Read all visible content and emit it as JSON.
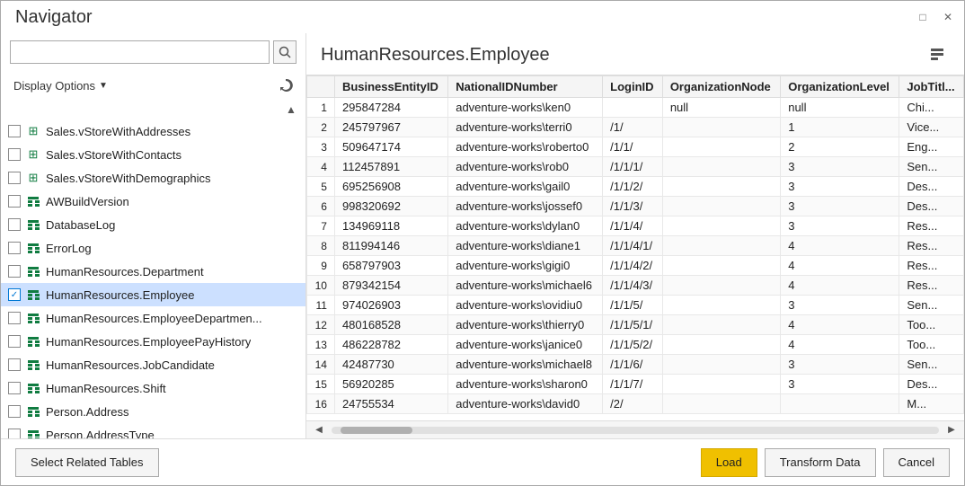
{
  "window": {
    "title": "Navigator",
    "preview_title": "HumanResources.Employee"
  },
  "titlebar": {
    "minimize_label": "□",
    "close_label": "✕"
  },
  "sidebar": {
    "search_placeholder": "",
    "display_options_label": "Display Options",
    "items": [
      {
        "id": "SalesStoreWithAddresses",
        "label": "Sales.vStoreWithAddresses",
        "type": "view",
        "checked": false,
        "selected": false
      },
      {
        "id": "SalesStoreWithContacts",
        "label": "Sales.vStoreWithContacts",
        "type": "view",
        "checked": false,
        "selected": false
      },
      {
        "id": "SalesStoreWithDemographics",
        "label": "Sales.vStoreWithDemographics",
        "type": "view",
        "checked": false,
        "selected": false
      },
      {
        "id": "AWBuildVersion",
        "label": "AWBuildVersion",
        "type": "table",
        "checked": false,
        "selected": false
      },
      {
        "id": "DatabaseLog",
        "label": "DatabaseLog",
        "type": "table",
        "checked": false,
        "selected": false
      },
      {
        "id": "ErrorLog",
        "label": "ErrorLog",
        "type": "table",
        "checked": false,
        "selected": false
      },
      {
        "id": "HumanResourcesDepartment",
        "label": "HumanResources.Department",
        "type": "table",
        "checked": false,
        "selected": false
      },
      {
        "id": "HumanResourcesEmployee",
        "label": "HumanResources.Employee",
        "type": "table",
        "checked": true,
        "selected": true
      },
      {
        "id": "HumanResourcesEmployeeDepartment",
        "label": "HumanResources.EmployeeDepartmen...",
        "type": "table",
        "checked": false,
        "selected": false
      },
      {
        "id": "HumanResourcesEmployeePayHistory",
        "label": "HumanResources.EmployeePayHistory",
        "type": "table",
        "checked": false,
        "selected": false
      },
      {
        "id": "HumanResourcesJobCandidate",
        "label": "HumanResources.JobCandidate",
        "type": "table",
        "checked": false,
        "selected": false
      },
      {
        "id": "HumanResourcesShift",
        "label": "HumanResources.Shift",
        "type": "table",
        "checked": false,
        "selected": false
      },
      {
        "id": "PersonAddress",
        "label": "Person.Address",
        "type": "table",
        "checked": false,
        "selected": false
      },
      {
        "id": "PersonAddressType",
        "label": "Person.AddressType",
        "type": "table",
        "checked": false,
        "selected": false
      }
    ]
  },
  "table": {
    "columns": [
      "",
      "BusinessEntityID",
      "NationalIDNumber",
      "LoginID",
      "OrganizationNode",
      "OrganizationLevel",
      "JobTitl..."
    ],
    "rows": [
      [
        "1",
        "295847284",
        "adventure-works\\ken0",
        "",
        "null",
        "null",
        "Chi..."
      ],
      [
        "2",
        "245797967",
        "adventure-works\\terri0",
        "/1/",
        "",
        "1",
        "Vice..."
      ],
      [
        "3",
        "509647174",
        "adventure-works\\roberto0",
        "/1/1/",
        "",
        "2",
        "Eng..."
      ],
      [
        "4",
        "112457891",
        "adventure-works\\rob0",
        "/1/1/1/",
        "",
        "3",
        "Sen..."
      ],
      [
        "5",
        "695256908",
        "adventure-works\\gail0",
        "/1/1/2/",
        "",
        "3",
        "Des..."
      ],
      [
        "6",
        "998320692",
        "adventure-works\\jossef0",
        "/1/1/3/",
        "",
        "3",
        "Des..."
      ],
      [
        "7",
        "134969118",
        "adventure-works\\dylan0",
        "/1/1/4/",
        "",
        "3",
        "Res..."
      ],
      [
        "8",
        "811994146",
        "adventure-works\\diane1",
        "/1/1/4/1/",
        "",
        "4",
        "Res..."
      ],
      [
        "9",
        "658797903",
        "adventure-works\\gigi0",
        "/1/1/4/2/",
        "",
        "4",
        "Res..."
      ],
      [
        "10",
        "879342154",
        "adventure-works\\michael6",
        "/1/1/4/3/",
        "",
        "4",
        "Res..."
      ],
      [
        "11",
        "974026903",
        "adventure-works\\ovidiu0",
        "/1/1/5/",
        "",
        "3",
        "Sen..."
      ],
      [
        "12",
        "480168528",
        "adventure-works\\thierry0",
        "/1/1/5/1/",
        "",
        "4",
        "Too..."
      ],
      [
        "13",
        "486228782",
        "adventure-works\\janice0",
        "/1/1/5/2/",
        "",
        "4",
        "Too..."
      ],
      [
        "14",
        "42487730",
        "adventure-works\\michael8",
        "/1/1/6/",
        "",
        "3",
        "Sen..."
      ],
      [
        "15",
        "56920285",
        "adventure-works\\sharon0",
        "/1/1/7/",
        "",
        "3",
        "Des..."
      ],
      [
        "16",
        "24755534",
        "adventure-works\\david0",
        "/2/",
        "",
        "",
        "M..."
      ]
    ]
  },
  "footer": {
    "select_related_tables_label": "Select Related Tables",
    "load_label": "Load",
    "transform_data_label": "Transform Data",
    "cancel_label": "Cancel"
  }
}
